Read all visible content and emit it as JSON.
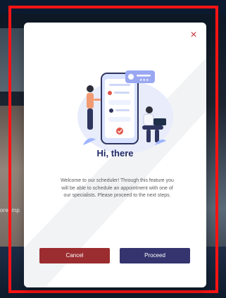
{
  "background": {
    "partial_text": "ore imp"
  },
  "modal": {
    "close_label": "×",
    "title": "Hi, there",
    "message": "Welcome to our scheduler! Through this feature you will be able to schedule an appointment with one of our specialists. Please proceed to the next steps.",
    "buttons": {
      "cancel": "Cancel",
      "proceed": "Proceed"
    }
  },
  "colors": {
    "highlight_border": "#ff1414",
    "title_navy": "#232c66",
    "cancel_red": "#9b2c2f",
    "proceed_navy": "#35346f",
    "close_red": "#c6353a"
  },
  "icons": {
    "close": "close-icon",
    "illustration": "scheduling-illustration"
  }
}
